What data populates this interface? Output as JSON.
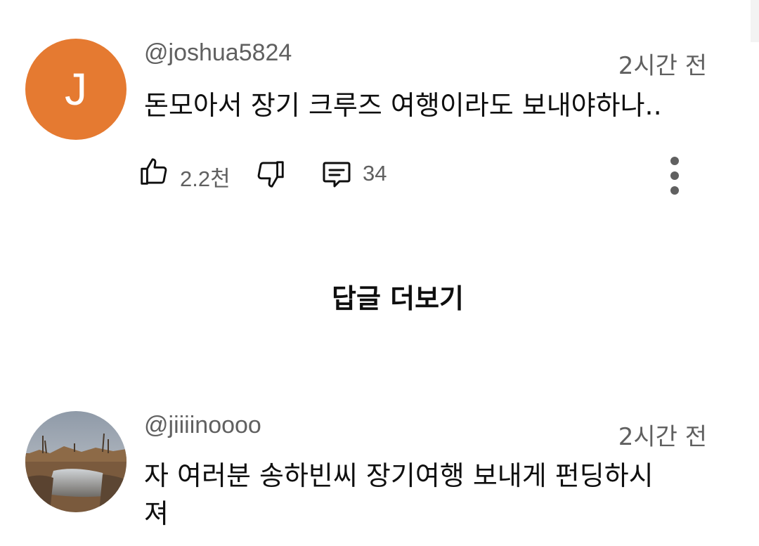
{
  "comments": [
    {
      "avatar_letter": "J",
      "avatar_color": "#e57a31",
      "handle": "@joshua5824",
      "time": "2시간 전",
      "text": "돈모아서 장기 크루즈 여행이라도 보내야하나..",
      "likes": "2.2천",
      "replies": "34"
    },
    {
      "avatar_letter": "",
      "handle": "@jiiiinoooo",
      "time": "2시간 전",
      "text": "자 여러분 송하빈씨 장기여행 보내게 펀딩하시\n져"
    }
  ],
  "more_replies_label": "답글 더보기",
  "icons": {
    "like": "thumbs-up-icon",
    "dislike": "thumbs-down-icon",
    "reply": "comment-icon",
    "menu": "more-vertical-icon"
  }
}
